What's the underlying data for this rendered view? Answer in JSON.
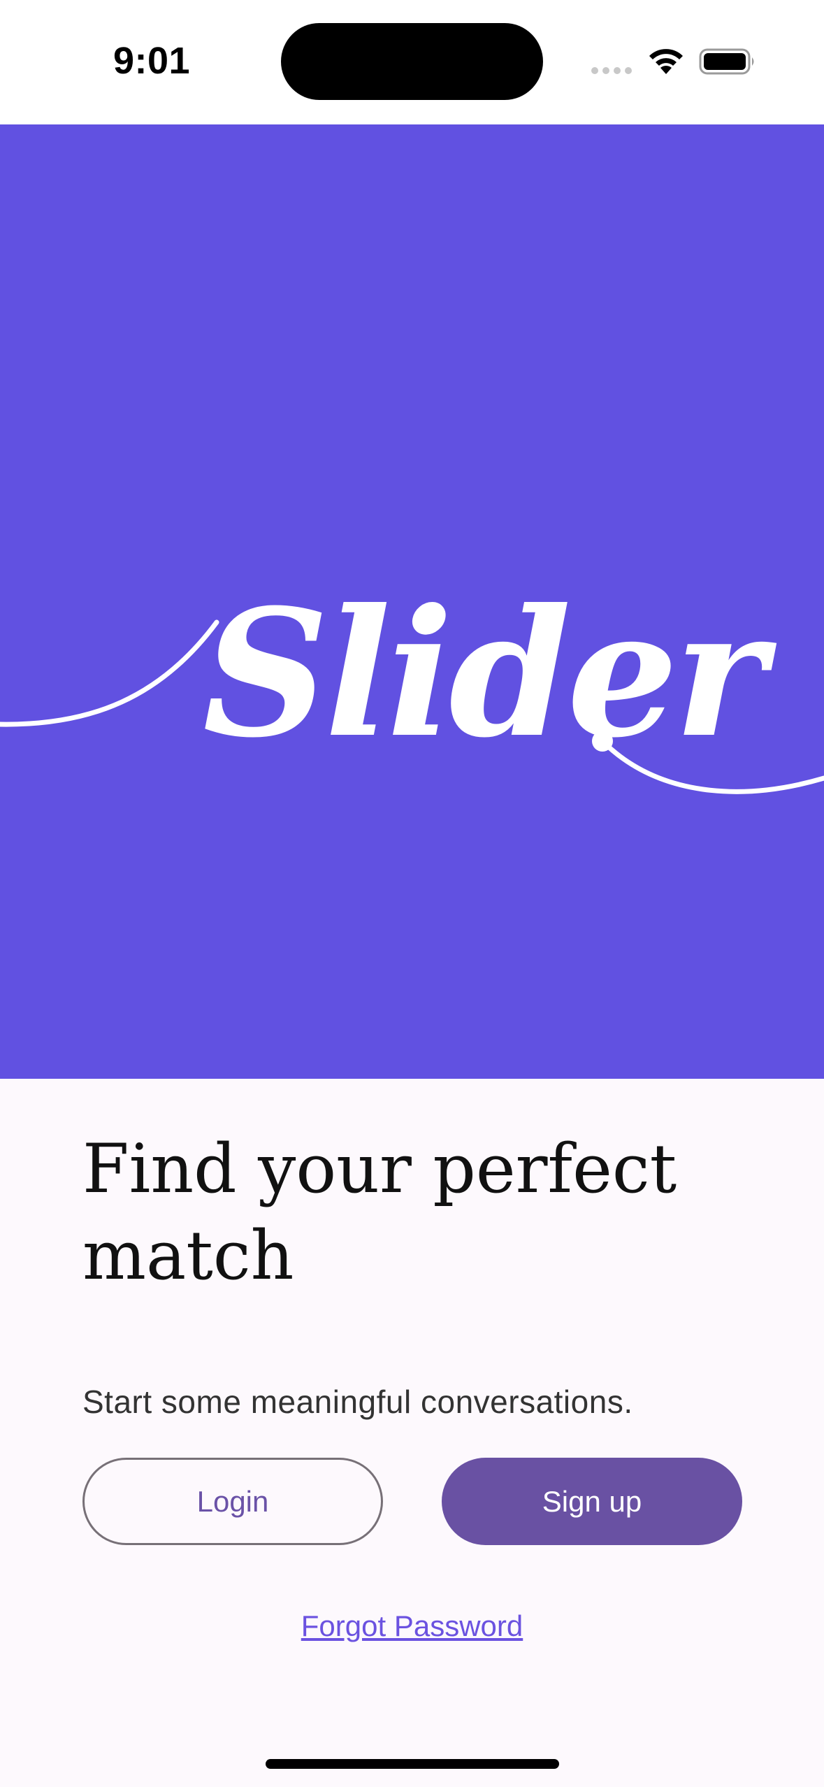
{
  "status_bar": {
    "time": "9:01"
  },
  "hero": {
    "logo_text": "Slider",
    "background_color": "#6151e1"
  },
  "content": {
    "headline_line1": "Find your perfect",
    "headline_line2": "match",
    "subtitle": "Start some meaningful conversations."
  },
  "actions": {
    "login_label": "Login",
    "signup_label": "Sign up",
    "forgot_label": "Forgot Password",
    "accent_color": "#6951a3"
  },
  "icons": {
    "signal": "cellular-signal-icon",
    "wifi": "wifi-icon",
    "battery": "battery-icon"
  }
}
